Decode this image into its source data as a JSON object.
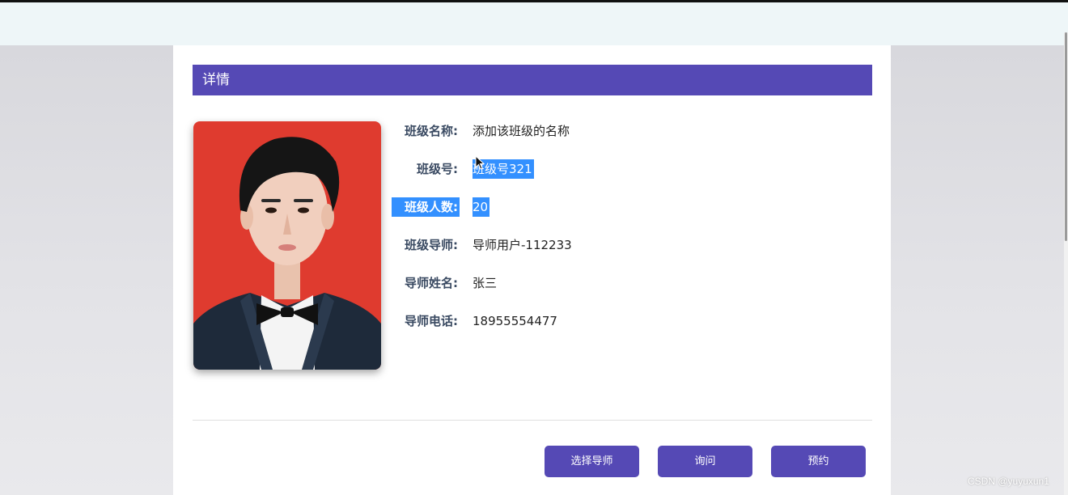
{
  "detail": {
    "header_title": "详情"
  },
  "fields": [
    {
      "label": "班级名称:",
      "value": "添加该班级的名称"
    },
    {
      "label": "班级号:",
      "value": "班级号321"
    },
    {
      "label": "班级人数:",
      "value": "20"
    },
    {
      "label": "班级导师:",
      "value": "导师用户-112233"
    },
    {
      "label": "导师姓名:",
      "value": "张三"
    },
    {
      "label": "导师电话:",
      "value": "18955554477"
    }
  ],
  "actions": {
    "choose_mentor_label": "选择导师",
    "inquire_label": "询问",
    "reserve_label": "预约"
  },
  "watermark": "CSDN @yuyuxun1",
  "colors": {
    "accent": "#5549b5",
    "selection": "#3390ff",
    "photo_background": "#e03a2e"
  },
  "icons": {
    "cursor": "arrow-cursor-icon"
  }
}
